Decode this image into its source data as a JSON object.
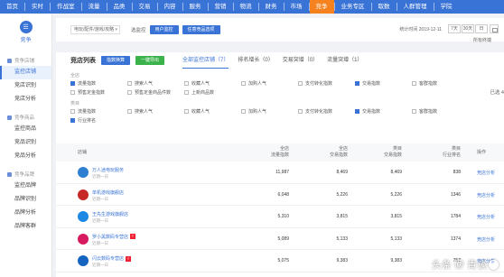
{
  "topnav": {
    "items": [
      "首页",
      "实时",
      "作战室",
      "流量",
      "品类",
      "交易",
      "内容",
      "服务",
      "营销",
      "物流",
      "财务",
      "市场",
      "竞争",
      "业务专区",
      "取数",
      "人群管理",
      "学院"
    ],
    "active_index": 12
  },
  "sidebar": {
    "brand": "竞争",
    "groups": [
      {
        "label": "竞争店铺",
        "items": [
          "监控店铺",
          "竞店识别",
          "竞店分析"
        ]
      },
      {
        "label": "竞争商品",
        "items": [
          "监控商品",
          "竞品识别",
          "竞品分析"
        ]
      },
      {
        "label": "竞争品牌",
        "items": [
          "监控品牌",
          "品牌识别",
          "品牌分析",
          "品牌客群"
        ]
      }
    ],
    "active": "监控店铺"
  },
  "filterbar": {
    "select_value": "电玩/配件/游戏/攻略",
    "select_label": "选监控",
    "btn1": "用户监控",
    "btn2": "任意竞品选项",
    "date": "统计时间 2019-12-11",
    "range_buttons": [
      "7天",
      "30天",
      "日"
    ],
    "all_category": "所有终端"
  },
  "panel": {
    "title": "竞店列表",
    "btn_blue": "指数换算",
    "btn_green": "一键导出",
    "tabs": [
      "全部监控店铺（7）",
      "排名增长（0）",
      "交易突增（0）",
      "流量突增（1）"
    ],
    "overflow": "已选 4",
    "group1_label": "全店",
    "group1_row1": [
      {
        "label": "流量指数",
        "on": true
      },
      {
        "label": "搜索人气",
        "on": false
      },
      {
        "label": "收藏人气",
        "on": false
      },
      {
        "label": "加购人气",
        "on": false
      },
      {
        "label": "支付转化指数",
        "on": false
      },
      {
        "label": "交易指数",
        "on": true
      },
      {
        "label": "客群指数",
        "on": false
      }
    ],
    "group1_row2": [
      {
        "label": "预售定金指数",
        "on": false
      },
      {
        "label": "预售定金商品件数",
        "on": false
      },
      {
        "label": "上新商品数",
        "on": false
      }
    ],
    "group2_label": "类目",
    "group2_row1": [
      {
        "label": "流量指数",
        "on": false
      },
      {
        "label": "搜索人气",
        "on": false
      },
      {
        "label": "收藏人气",
        "on": false
      },
      {
        "label": "加购人气",
        "on": false
      },
      {
        "label": "支付转化指数",
        "on": false
      },
      {
        "label": "交易指数",
        "on": true
      },
      {
        "label": "客群指数",
        "on": false
      }
    ],
    "group2_row2": [
      {
        "label": "行业排名",
        "on": true
      }
    ]
  },
  "table": {
    "headers": {
      "shop": "店铺",
      "c1": [
        "全店",
        "流量指数"
      ],
      "c2": [
        "全店",
        "交易指数"
      ],
      "c3": [
        "类目",
        "交易指数"
      ],
      "c4": [
        "类目",
        "行业排名"
      ],
      "op": "操作"
    },
    "rows": [
      {
        "name": "万人迷电玩服务",
        "sub": "近期一日",
        "tag": "",
        "avatar": "#2f7fd0",
        "v1": "11,987",
        "v2": "8,469",
        "v3": "8,469",
        "v4": "838",
        "op": "竞店分析"
      },
      {
        "name": "单机游戏旗舰店",
        "sub": "近期一日",
        "tag": "",
        "avatar": "#c62828",
        "v1": "6,048",
        "v2": "5,226",
        "v3": "5,226",
        "v4": "1346",
        "op": "竞店分析"
      },
      {
        "name": "王先生游戏旗舰店",
        "sub": "近期一日",
        "tag": "",
        "avatar": "#1e88e5",
        "v1": "5,310",
        "v2": "3,815",
        "v3": "3,815",
        "v4": "1784",
        "op": "竞店分析"
      },
      {
        "name": "罗小黑数码专营店",
        "sub": "近期一日",
        "tag": "T",
        "avatar": "#d81b60",
        "v1": "5,089",
        "v2": "5,133",
        "v3": "5,133",
        "v4": "1374",
        "op": "竞店分析"
      },
      {
        "name": "闪云数码专营店",
        "sub": "近期一日",
        "tag": "T",
        "avatar": "#1565c0",
        "v1": "5,075",
        "v2": "9,383",
        "v3": "9,383",
        "v4": "757",
        "op": "竞店分析"
      }
    ]
  },
  "watermark": {
    "left": "头条",
    "right": "青谈"
  }
}
